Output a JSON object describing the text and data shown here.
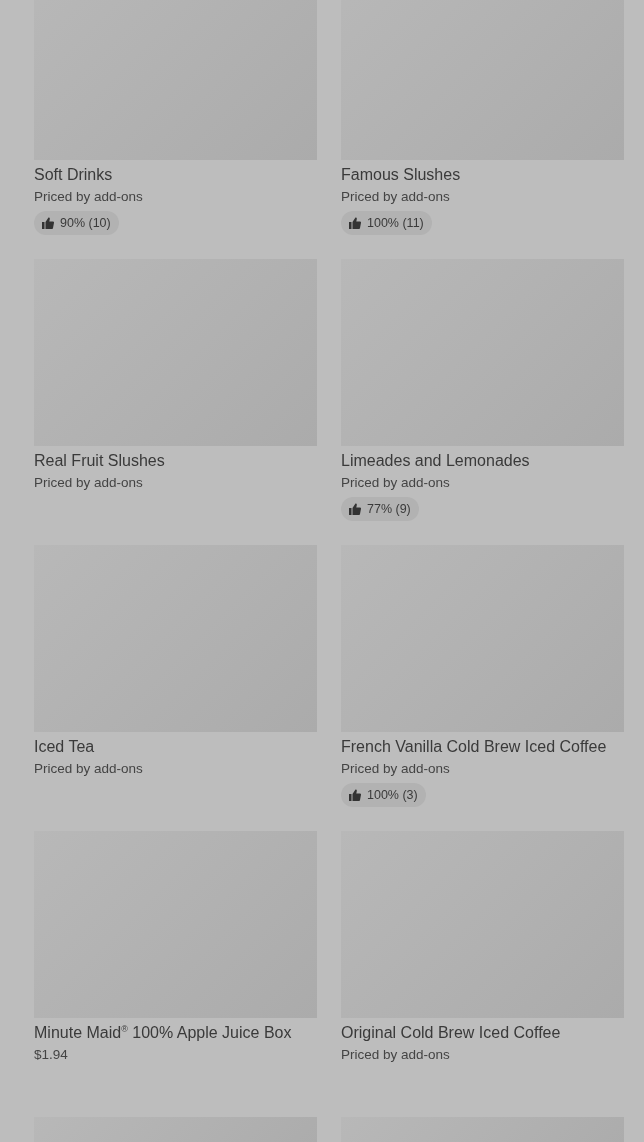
{
  "items": [
    {
      "kind": "product",
      "name": "Soft Drinks",
      "price": "Priced by add-ons",
      "rating": "90% (10)"
    },
    {
      "kind": "product",
      "name": "Famous Slushes",
      "price": "Priced by add-ons",
      "rating": "100% (11)"
    },
    {
      "kind": "product",
      "name": "Real Fruit Slushes",
      "price": "Priced by add-ons"
    },
    {
      "kind": "product",
      "name": "Limeades and Lemonades",
      "price": "Priced by add-ons",
      "rating": "77% (9)"
    },
    {
      "kind": "product",
      "name": "Iced Tea",
      "price": "Priced by add-ons"
    },
    {
      "kind": "product",
      "name": "French Vanilla Cold Brew Iced Coffee",
      "price": "Priced by add-ons",
      "rating": "100% (3)"
    },
    {
      "kind": "product",
      "name": "Minute Maid$^{®}$ 100% Apple Juice Box",
      "price": "$1.94"
    },
    {
      "kind": "product",
      "name": "Original Cold Brew Iced Coffee",
      "price": "Priced by add-ons"
    },
    {
      "kind": "placeholder"
    },
    {
      "kind": "placeholder"
    }
  ]
}
